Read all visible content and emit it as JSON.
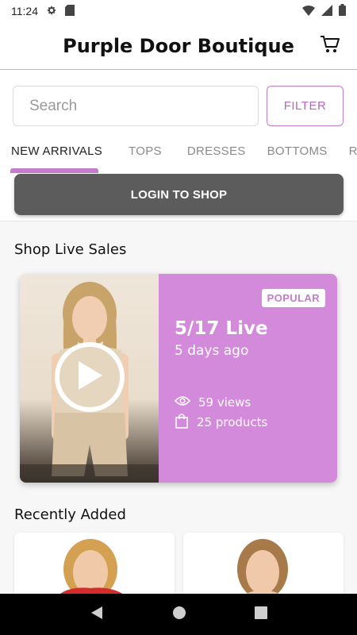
{
  "status_bar": {
    "time": "11:24",
    "icons": [
      "settings-icon",
      "sd-card-icon",
      "wifi-icon",
      "signal-icon",
      "battery-icon"
    ]
  },
  "header": {
    "title": "Purple Door Boutique",
    "cart_icon": "cart-icon"
  },
  "search": {
    "placeholder": "Search",
    "value": "",
    "filter_label": "FILTER"
  },
  "tabs": [
    {
      "label": "NEW ARRIVALS",
      "active": true
    },
    {
      "label": "TOPS",
      "active": false
    },
    {
      "label": "DRESSES",
      "active": false
    },
    {
      "label": "BOTTOMS",
      "active": false
    },
    {
      "label": "RO",
      "active": false
    }
  ],
  "login": {
    "label": "LOGIN TO SHOP"
  },
  "live_sales": {
    "section_title": "Shop Live Sales",
    "card": {
      "badge": "POPULAR",
      "title": "5/17 Live",
      "date": "5 days ago",
      "views": "59 views",
      "products": "25 products"
    }
  },
  "recently_added": {
    "section_title": "Recently Added"
  },
  "colors": {
    "accent": "#c47ccb",
    "card_purple": "#d48adb",
    "login_bg": "#5c5c5c"
  },
  "nav": {
    "icons": [
      "back-icon",
      "home-icon",
      "recents-icon"
    ]
  }
}
